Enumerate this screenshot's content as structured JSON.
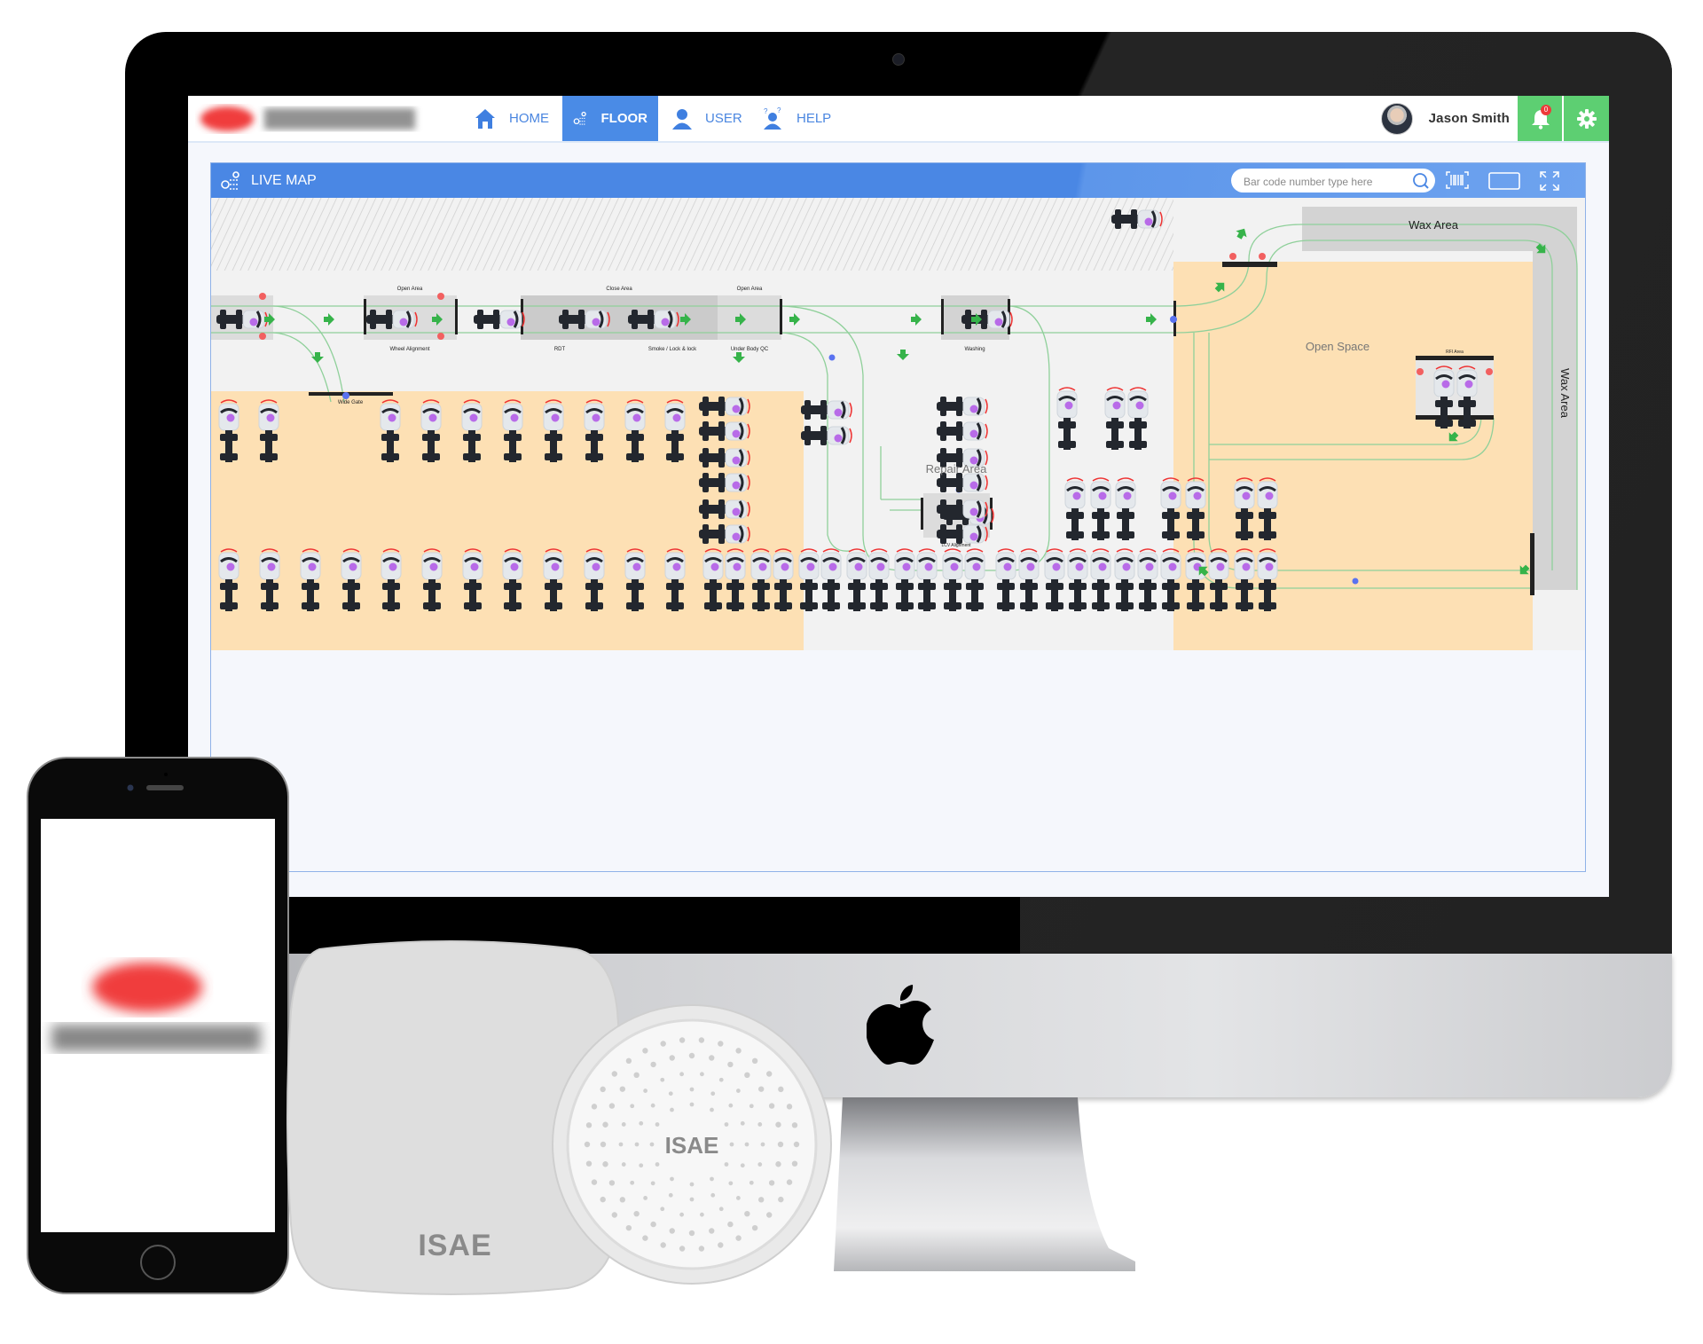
{
  "app": {
    "brand_logo": "blurred-company-logo",
    "nav": [
      {
        "label": "HOME",
        "icon": "home-icon",
        "active": false
      },
      {
        "label": "FLOOR",
        "icon": "floor-map-icon",
        "active": true
      },
      {
        "label": "USER",
        "icon": "user-icon",
        "active": false
      },
      {
        "label": "HELP",
        "icon": "help-icon",
        "active": false
      }
    ],
    "user": {
      "name": "Jason Smith",
      "avatar": "user-avatar"
    },
    "notifications": {
      "count": "0",
      "icon": "bell-icon"
    },
    "settings_icon": "gear-icon",
    "colors": {
      "accent": "#4a87e4",
      "green": "#5dcf72",
      "parking": "#fde0b4",
      "badge": "#ee3a3a"
    }
  },
  "live_map": {
    "title": "LIVE MAP",
    "search": {
      "placeholder": "Bar code number type here",
      "value": ""
    },
    "toolbar_icons": [
      "search-icon",
      "barcode-icon",
      "screen-icon",
      "expand-icon"
    ],
    "labels": {
      "open_area_1": "Open Area",
      "wheel_alignment": "Wheel Alignment",
      "close_area": "Close Area",
      "rdt": "RDT",
      "smoke": "Smoke / Lock & lock",
      "open_area_2": "Open Area",
      "under_body": "Under Body QC",
      "washing": "Washing",
      "wide_gate": "Wide Gate",
      "repair_area": "Repair Area",
      "lcv_alignment": "LCV Alignment",
      "wax_area_top": "Wax Area",
      "wax_area_side": "Wax Area",
      "open_space": "Open Space",
      "rfi_area": "RFI Area"
    }
  },
  "devices": {
    "square_device_brand": "ISAE",
    "round_device_brand": "ISAE"
  }
}
